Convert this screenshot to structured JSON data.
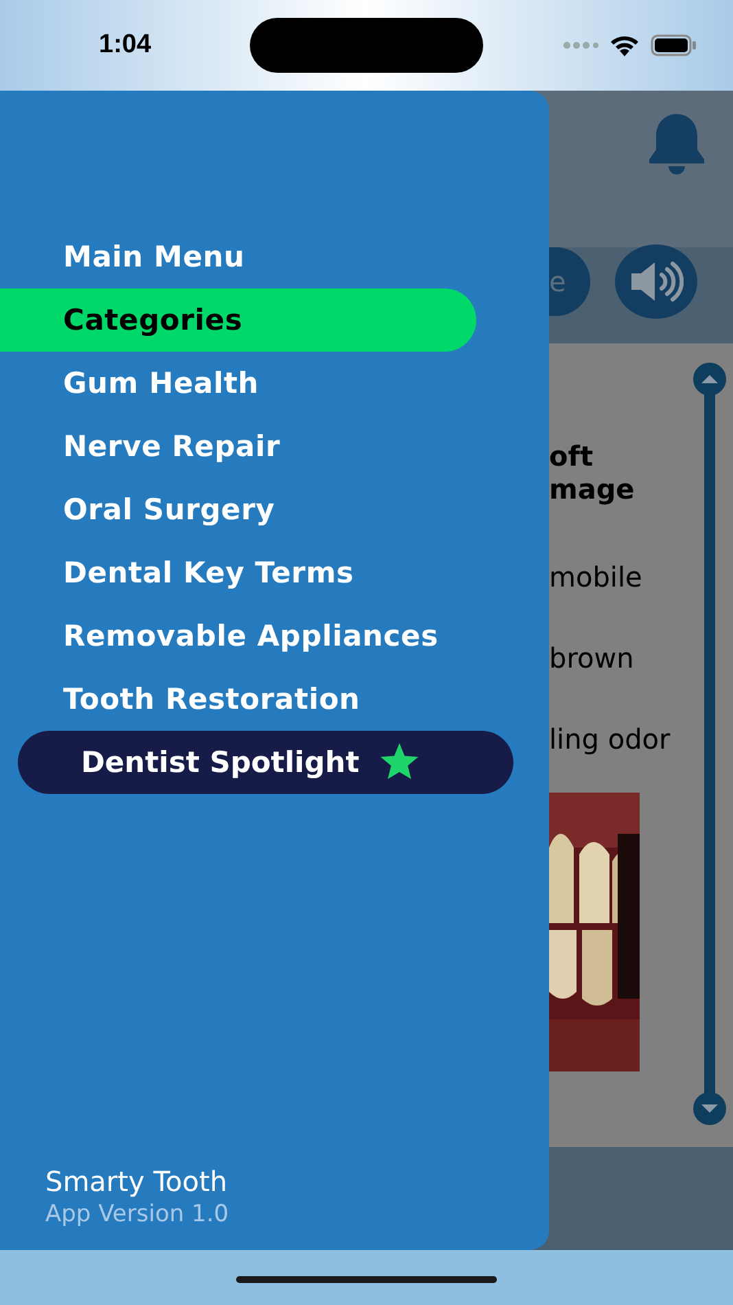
{
  "status_bar": {
    "time": "1:04"
  },
  "toolbar": {
    "pill_text": "e"
  },
  "content_fragments": [
    {
      "text": "oft",
      "kind": "heading"
    },
    {
      "text": "mage",
      "kind": "heading"
    },
    {
      "text": "mobile",
      "kind": "bullet"
    },
    {
      "text": "brown",
      "kind": "bullet"
    },
    {
      "text": "ling odor",
      "kind": "bullet"
    }
  ],
  "menu": {
    "items": [
      {
        "label": "Main Menu",
        "selected": false,
        "kind": "item"
      },
      {
        "label": "Categories",
        "selected": true,
        "kind": "item"
      },
      {
        "label": "Gum Health",
        "selected": false,
        "kind": "item"
      },
      {
        "label": "Nerve Repair",
        "selected": false,
        "kind": "item"
      },
      {
        "label": "Oral Surgery",
        "selected": false,
        "kind": "item"
      },
      {
        "label": "Dental Key Terms",
        "selected": false,
        "kind": "item"
      },
      {
        "label": "Removable Appliances",
        "selected": false,
        "kind": "item"
      },
      {
        "label": "Tooth Restoration",
        "selected": false,
        "kind": "item"
      },
      {
        "label": "Dentist Spotlight",
        "selected": false,
        "kind": "spotlight"
      }
    ]
  },
  "footer": {
    "app_name": "Smarty Tooth",
    "version": "App Version 1.0"
  }
}
